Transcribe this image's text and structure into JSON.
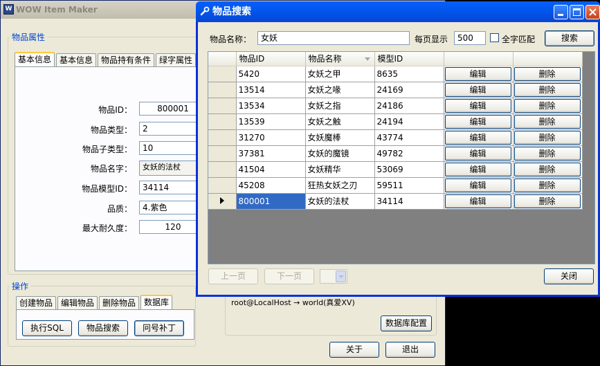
{
  "main_window": {
    "title": "WOW Item Maker",
    "app_icon_label": "W",
    "properties_group": "物品属性",
    "tabs": [
      "基本信息",
      "基本信息",
      "物品持有条件",
      "绿字属性"
    ],
    "fields": [
      {
        "label": "物品ID：",
        "value": "800001"
      },
      {
        "label": "物品类型：",
        "value": "2"
      },
      {
        "label": "物品子类型：",
        "value": "10"
      },
      {
        "label": "物品名字：",
        "value": "女妖的法杖"
      },
      {
        "label": "物品模型ID：",
        "value": "34114"
      },
      {
        "label": "品质：",
        "value": "4.紫色"
      },
      {
        "label": "最大耐久度：",
        "value": "120"
      }
    ],
    "ops_group": "操作",
    "op_tabs": [
      "创建物品",
      "编辑物品",
      "删除物品",
      "数据库"
    ],
    "op_buttons": [
      "执行SQL",
      "物品搜索",
      "冋号补丁"
    ],
    "connection_text": "root@LocalHost → world(真爱XV)",
    "db_config_button": "数据库配置",
    "about_button": "关于",
    "exit_button": "退出"
  },
  "search_window": {
    "title": "物品搜索",
    "name_label": "物品名称：",
    "name_value": "女妖",
    "per_page_label": "每页显示",
    "per_page_value": "500",
    "exact_match_label": "全字匹配",
    "exact_match_checked": false,
    "search_button": "搜索",
    "columns": [
      "物品ID",
      "物品名称",
      "模型ID"
    ],
    "sorted_column": "物品名称",
    "rows": [
      {
        "id": "5420",
        "name": "女妖之甲",
        "model": "8635",
        "edit": "编辑",
        "delete": "删除"
      },
      {
        "id": "13514",
        "name": "女妖之喙",
        "model": "24169",
        "edit": "编辑",
        "delete": "删除"
      },
      {
        "id": "13534",
        "name": "女妖之指",
        "model": "24186",
        "edit": "编辑",
        "delete": "删除"
      },
      {
        "id": "13539",
        "name": "女妖之触",
        "model": "24194",
        "edit": "编辑",
        "delete": "删除"
      },
      {
        "id": "31270",
        "name": "女妖魔棒",
        "model": "43774",
        "edit": "编辑",
        "delete": "删除"
      },
      {
        "id": "37381",
        "name": "女妖的魔镜",
        "model": "49782",
        "edit": "编辑",
        "delete": "删除"
      },
      {
        "id": "41504",
        "name": "女妖精华",
        "model": "53069",
        "edit": "编辑",
        "delete": "删除"
      },
      {
        "id": "45208",
        "name": "狂热女妖之刃",
        "model": "59511",
        "edit": "编辑",
        "delete": "删除"
      },
      {
        "id": "800001",
        "name": "女妖的法杖",
        "model": "34114",
        "edit": "编辑",
        "delete": "删除",
        "selected": true
      }
    ],
    "prev_button": "上一页",
    "next_button": "下一页",
    "page_select_value": "",
    "close_button": "关闭"
  },
  "colors": {
    "title_active": "#0058ee",
    "selection": "#316ac5",
    "group_label": "#0046d5",
    "tab_highlight": "#ffc83c"
  }
}
